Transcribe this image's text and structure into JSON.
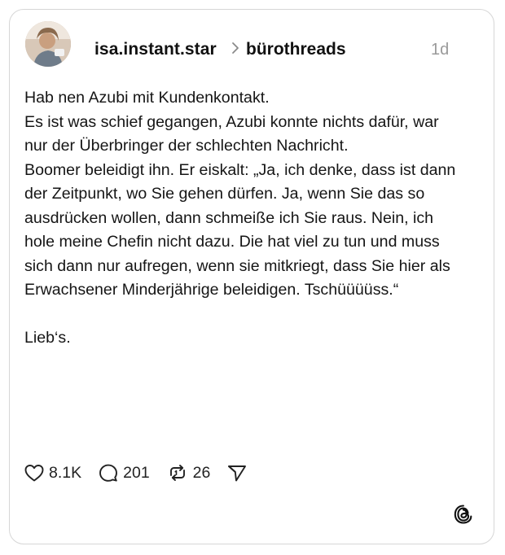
{
  "post": {
    "author": "isa.instant.star",
    "community": "bürothreads",
    "time": "1d",
    "paragraphs": [
      "Hab nen Azubi mit Kundenkontakt.\nEs ist was schief gegangen, Azubi konnte nichts dafür, war nur der Überbringer der schlechten Nachricht.\nBoomer beleidigt ihn. Er eiskalt: „Ja, ich denke, dass ist dann der Zeitpunkt, wo Sie gehen dürfen. Ja, wenn Sie das so ausdrücken wollen, dann schmeiße ich Sie raus. Nein, ich hole meine Chefin nicht dazu. Die hat viel zu tun und muss sich dann nur aufregen, wenn sie mitkriegt, dass Sie hier als Erwachsener Minderjährige beleidigen. Tschüüüüss.“",
      "Lieb‘s."
    ]
  },
  "actions": {
    "likes": "8.1K",
    "replies": "201",
    "reposts": "26"
  },
  "icons": {
    "like": "heart-icon",
    "reply": "speech-bubble-icon",
    "repost": "repost-icon",
    "share": "send-icon",
    "brand": "threads-logo-icon"
  }
}
